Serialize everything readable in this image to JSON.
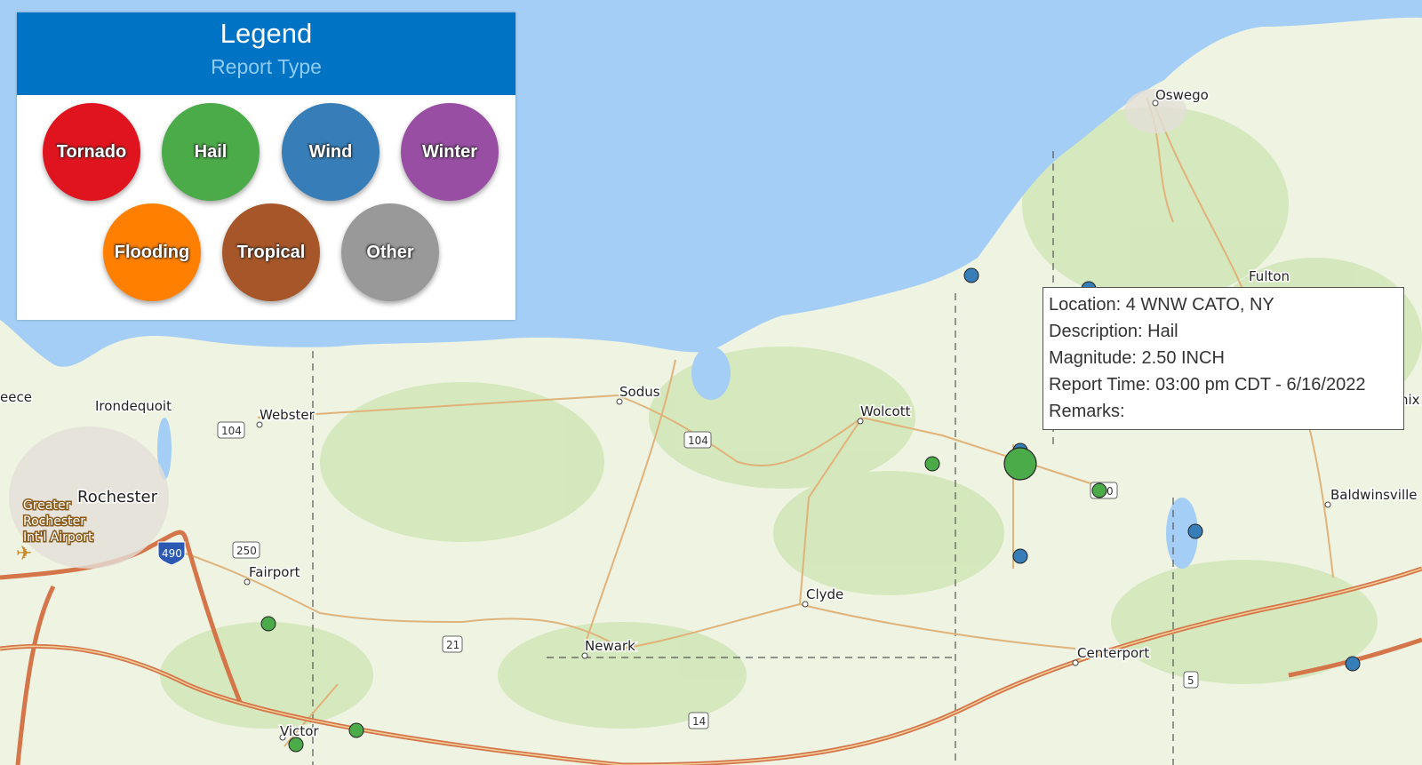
{
  "legend": {
    "title": "Legend",
    "subtitle": "Report Type",
    "items": [
      {
        "label": "Tornado",
        "color": "#e0141e"
      },
      {
        "label": "Hail",
        "color": "#4aab48"
      },
      {
        "label": "Wind",
        "color": "#377eb8"
      },
      {
        "label": "Winter",
        "color": "#984ea3"
      },
      {
        "label": "Flooding",
        "color": "#ff7f00"
      },
      {
        "label": "Tropical",
        "color": "#a65628"
      },
      {
        "label": "Other",
        "color": "#999999"
      }
    ]
  },
  "popup": {
    "location": "Location: 4 WNW CATO, NY",
    "description": "Description: Hail",
    "magnitude": "Magnitude: 2.50 INCH",
    "report_time": "Report Time: 03:00 pm CDT - 6/16/2022",
    "remarks": "Remarks:"
  },
  "map": {
    "places": [
      "Oswego",
      "Fulton",
      "eece",
      "Irondequoit",
      "Webster",
      "Sodus",
      "Wolcott",
      "Rochester",
      "Fairport",
      "Clyde",
      "Newark",
      "Centerport",
      "Victor",
      "Baldwinsville",
      "nix"
    ],
    "airport": [
      "Greater",
      "Rochester",
      "Int'l Airport"
    ],
    "route_shields": [
      "104",
      "104",
      "250",
      "490",
      "21",
      "14",
      "5",
      "0"
    ],
    "colors": {
      "water": "#a4cef6",
      "land": "#eef3e2",
      "forest": "#cfe4b4",
      "highway": "#d4754a",
      "road": "#e0b37a"
    }
  }
}
